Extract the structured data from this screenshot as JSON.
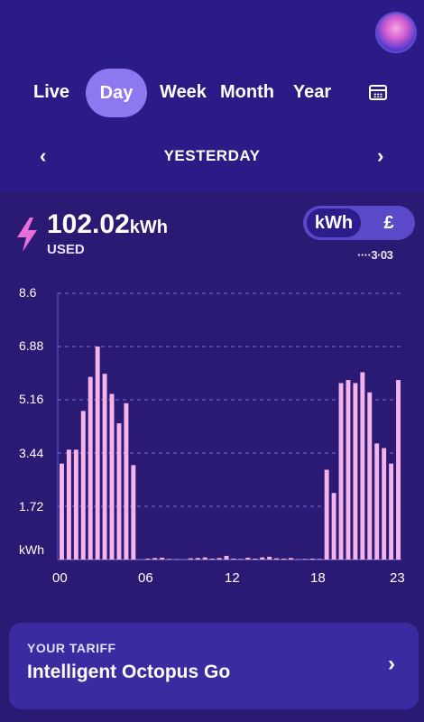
{
  "tabs": [
    {
      "label": "Live",
      "active": false
    },
    {
      "label": "Day",
      "active": true
    },
    {
      "label": "Week",
      "active": false
    },
    {
      "label": "Month",
      "active": false
    },
    {
      "label": "Year",
      "active": false
    }
  ],
  "date_nav": {
    "label": "YESTERDAY",
    "prev": "‹",
    "next": "›"
  },
  "usage": {
    "value": "102.02",
    "unit": "kWh",
    "label": "USED"
  },
  "unit_toggle": {
    "options": [
      "kWh",
      "£"
    ],
    "selected": "kWh"
  },
  "cost_text": "····3·03",
  "tariff": {
    "label": "YOUR TARIFF",
    "name": "Intelligent Octopus Go",
    "chevron": "›"
  },
  "colors": {
    "bar": "#f4b4ea",
    "accent": "#8e78f2",
    "background": "#2a1a73"
  },
  "chart_data": {
    "type": "bar",
    "y_unit_label": "kWh",
    "ylim": [
      0,
      8.6
    ],
    "y_ticks": [
      "8.6",
      "6.88",
      "5.16",
      "3.44",
      "1.72"
    ],
    "x_ticks": [
      "00",
      "06",
      "12",
      "18",
      "23"
    ],
    "categories": [
      "00",
      "",
      "01",
      "",
      "02",
      "",
      "03",
      "",
      "04",
      "",
      "05",
      "",
      "06",
      "",
      "07",
      "",
      "08",
      "",
      "09",
      "",
      "10",
      "",
      "11",
      "",
      "12",
      "",
      "13",
      "",
      "14",
      "",
      "15",
      "",
      "16",
      "",
      "17",
      "",
      "18",
      "",
      "19",
      "",
      "20",
      "",
      "21",
      "",
      "22",
      "",
      "23",
      ""
    ],
    "values": [
      3.1,
      3.55,
      3.55,
      4.8,
      5.9,
      6.88,
      6.0,
      5.35,
      4.4,
      5.05,
      3.05,
      0,
      0.03,
      0.05,
      0.06,
      0.02,
      0.01,
      0,
      0.04,
      0.05,
      0.07,
      0.03,
      0.05,
      0.12,
      0.03,
      0.02,
      0.06,
      0.03,
      0.07,
      0.09,
      0.04,
      0.03,
      0.05,
      0.01,
      0.02,
      0.03,
      0.02,
      2.9,
      2.15,
      5.7,
      5.8,
      5.7,
      6.05,
      5.4,
      3.75,
      3.6,
      3.1,
      5.8
    ]
  }
}
